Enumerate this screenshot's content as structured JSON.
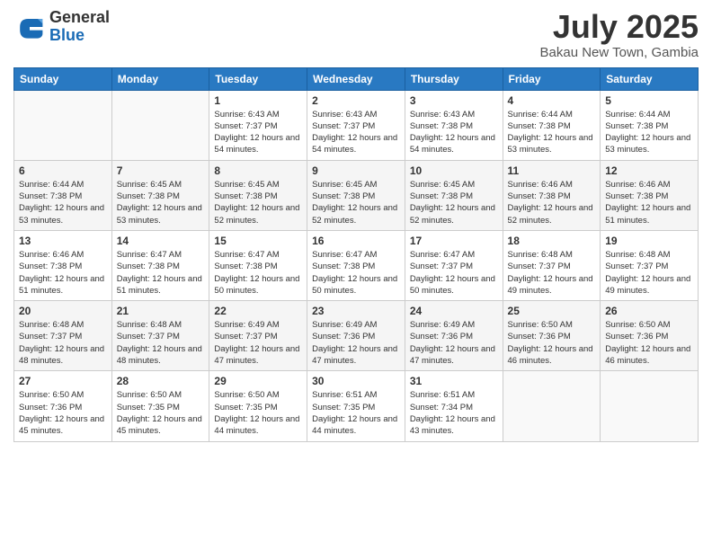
{
  "header": {
    "logo_general": "General",
    "logo_blue": "Blue",
    "month_title": "July 2025",
    "subtitle": "Bakau New Town, Gambia"
  },
  "days_of_week": [
    "Sunday",
    "Monday",
    "Tuesday",
    "Wednesday",
    "Thursday",
    "Friday",
    "Saturday"
  ],
  "weeks": [
    [
      {
        "day": "",
        "info": ""
      },
      {
        "day": "",
        "info": ""
      },
      {
        "day": "1",
        "info": "Sunrise: 6:43 AM\nSunset: 7:37 PM\nDaylight: 12 hours and 54 minutes."
      },
      {
        "day": "2",
        "info": "Sunrise: 6:43 AM\nSunset: 7:37 PM\nDaylight: 12 hours and 54 minutes."
      },
      {
        "day": "3",
        "info": "Sunrise: 6:43 AM\nSunset: 7:38 PM\nDaylight: 12 hours and 54 minutes."
      },
      {
        "day": "4",
        "info": "Sunrise: 6:44 AM\nSunset: 7:38 PM\nDaylight: 12 hours and 53 minutes."
      },
      {
        "day": "5",
        "info": "Sunrise: 6:44 AM\nSunset: 7:38 PM\nDaylight: 12 hours and 53 minutes."
      }
    ],
    [
      {
        "day": "6",
        "info": "Sunrise: 6:44 AM\nSunset: 7:38 PM\nDaylight: 12 hours and 53 minutes."
      },
      {
        "day": "7",
        "info": "Sunrise: 6:45 AM\nSunset: 7:38 PM\nDaylight: 12 hours and 53 minutes."
      },
      {
        "day": "8",
        "info": "Sunrise: 6:45 AM\nSunset: 7:38 PM\nDaylight: 12 hours and 52 minutes."
      },
      {
        "day": "9",
        "info": "Sunrise: 6:45 AM\nSunset: 7:38 PM\nDaylight: 12 hours and 52 minutes."
      },
      {
        "day": "10",
        "info": "Sunrise: 6:45 AM\nSunset: 7:38 PM\nDaylight: 12 hours and 52 minutes."
      },
      {
        "day": "11",
        "info": "Sunrise: 6:46 AM\nSunset: 7:38 PM\nDaylight: 12 hours and 52 minutes."
      },
      {
        "day": "12",
        "info": "Sunrise: 6:46 AM\nSunset: 7:38 PM\nDaylight: 12 hours and 51 minutes."
      }
    ],
    [
      {
        "day": "13",
        "info": "Sunrise: 6:46 AM\nSunset: 7:38 PM\nDaylight: 12 hours and 51 minutes."
      },
      {
        "day": "14",
        "info": "Sunrise: 6:47 AM\nSunset: 7:38 PM\nDaylight: 12 hours and 51 minutes."
      },
      {
        "day": "15",
        "info": "Sunrise: 6:47 AM\nSunset: 7:38 PM\nDaylight: 12 hours and 50 minutes."
      },
      {
        "day": "16",
        "info": "Sunrise: 6:47 AM\nSunset: 7:38 PM\nDaylight: 12 hours and 50 minutes."
      },
      {
        "day": "17",
        "info": "Sunrise: 6:47 AM\nSunset: 7:37 PM\nDaylight: 12 hours and 50 minutes."
      },
      {
        "day": "18",
        "info": "Sunrise: 6:48 AM\nSunset: 7:37 PM\nDaylight: 12 hours and 49 minutes."
      },
      {
        "day": "19",
        "info": "Sunrise: 6:48 AM\nSunset: 7:37 PM\nDaylight: 12 hours and 49 minutes."
      }
    ],
    [
      {
        "day": "20",
        "info": "Sunrise: 6:48 AM\nSunset: 7:37 PM\nDaylight: 12 hours and 48 minutes."
      },
      {
        "day": "21",
        "info": "Sunrise: 6:48 AM\nSunset: 7:37 PM\nDaylight: 12 hours and 48 minutes."
      },
      {
        "day": "22",
        "info": "Sunrise: 6:49 AM\nSunset: 7:37 PM\nDaylight: 12 hours and 47 minutes."
      },
      {
        "day": "23",
        "info": "Sunrise: 6:49 AM\nSunset: 7:36 PM\nDaylight: 12 hours and 47 minutes."
      },
      {
        "day": "24",
        "info": "Sunrise: 6:49 AM\nSunset: 7:36 PM\nDaylight: 12 hours and 47 minutes."
      },
      {
        "day": "25",
        "info": "Sunrise: 6:50 AM\nSunset: 7:36 PM\nDaylight: 12 hours and 46 minutes."
      },
      {
        "day": "26",
        "info": "Sunrise: 6:50 AM\nSunset: 7:36 PM\nDaylight: 12 hours and 46 minutes."
      }
    ],
    [
      {
        "day": "27",
        "info": "Sunrise: 6:50 AM\nSunset: 7:36 PM\nDaylight: 12 hours and 45 minutes."
      },
      {
        "day": "28",
        "info": "Sunrise: 6:50 AM\nSunset: 7:35 PM\nDaylight: 12 hours and 45 minutes."
      },
      {
        "day": "29",
        "info": "Sunrise: 6:50 AM\nSunset: 7:35 PM\nDaylight: 12 hours and 44 minutes."
      },
      {
        "day": "30",
        "info": "Sunrise: 6:51 AM\nSunset: 7:35 PM\nDaylight: 12 hours and 44 minutes."
      },
      {
        "day": "31",
        "info": "Sunrise: 6:51 AM\nSunset: 7:34 PM\nDaylight: 12 hours and 43 minutes."
      },
      {
        "day": "",
        "info": ""
      },
      {
        "day": "",
        "info": ""
      }
    ]
  ]
}
